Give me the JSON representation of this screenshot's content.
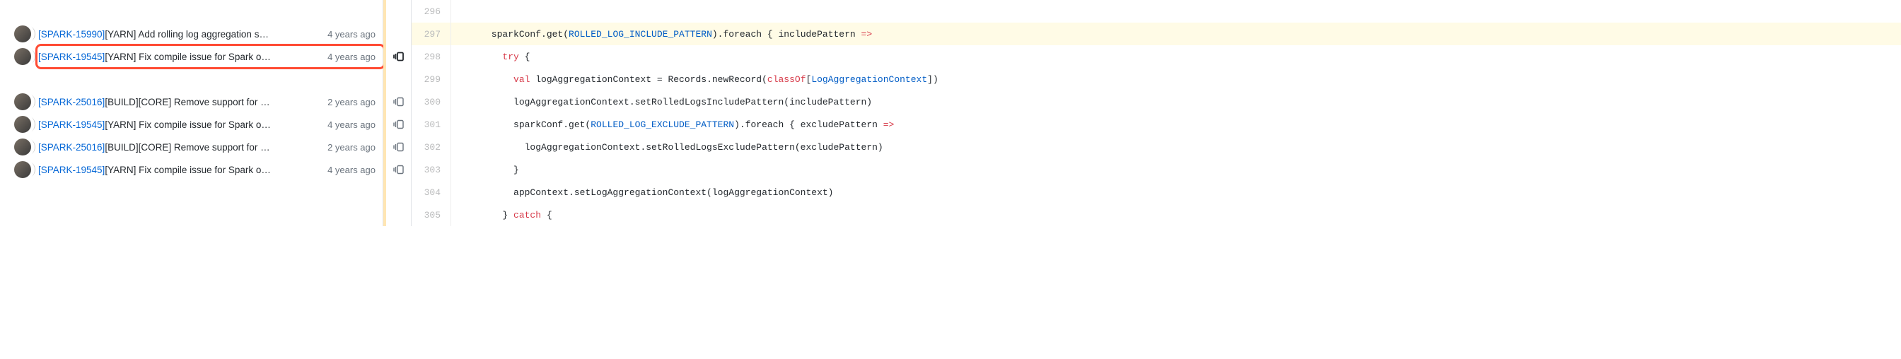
{
  "blame": [
    {
      "issue": "[SPARK-15990]",
      "rest": "[YARN] Add rolling log aggregation s…",
      "age": "4 years ago",
      "avatar": true,
      "reblame": false,
      "highlight": false
    },
    {
      "issue": "[SPARK-19545]",
      "rest": "[YARN] Fix compile issue for Spark o…",
      "age": "4 years ago",
      "avatar": true,
      "reblame": true,
      "highlight": true,
      "reblame_bold": true
    },
    {
      "blank": true
    },
    {
      "issue": "[SPARK-25016]",
      "rest": "[BUILD][CORE] Remove support for …",
      "age": "2 years ago",
      "avatar": true,
      "reblame": true,
      "highlight": false
    },
    {
      "issue": "[SPARK-19545]",
      "rest": "[YARN] Fix compile issue for Spark o…",
      "age": "4 years ago",
      "avatar": true,
      "reblame": true,
      "highlight": false
    },
    {
      "issue": "[SPARK-25016]",
      "rest": "[BUILD][CORE] Remove support for …",
      "age": "2 years ago",
      "avatar": true,
      "reblame": true,
      "highlight": false
    },
    {
      "issue": "[SPARK-19545]",
      "rest": "[YARN] Fix compile issue for Spark o…",
      "age": "4 years ago",
      "avatar": true,
      "reblame": true,
      "highlight": false
    },
    {
      "blank": true
    },
    {
      "blank": true
    }
  ],
  "code": [
    {
      "n": 296,
      "hl": false,
      "segs": []
    },
    {
      "n": 297,
      "hl": true,
      "segs": [
        {
          "t": "      sparkConf.get("
        },
        {
          "t": "ROLLED_LOG_INCLUDE_PATTERN",
          "c": "const"
        },
        {
          "t": ").foreach { includePattern "
        },
        {
          "t": "=>",
          "c": "kw"
        }
      ]
    },
    {
      "n": 298,
      "hl": false,
      "segs": [
        {
          "t": "        "
        },
        {
          "t": "try",
          "c": "kw"
        },
        {
          "t": " {"
        }
      ]
    },
    {
      "n": 299,
      "hl": false,
      "segs": [
        {
          "t": "          "
        },
        {
          "t": "val",
          "c": "kw"
        },
        {
          "t": " logAggregationContext = Records.newRecord("
        },
        {
          "t": "classOf",
          "c": "kw"
        },
        {
          "t": "["
        },
        {
          "t": "LogAggregationContext",
          "c": "const"
        },
        {
          "t": "])"
        }
      ]
    },
    {
      "n": 300,
      "hl": false,
      "segs": [
        {
          "t": "          logAggregationContext.setRolledLogsIncludePattern(includePattern)"
        }
      ]
    },
    {
      "n": 301,
      "hl": false,
      "segs": [
        {
          "t": "          sparkConf.get("
        },
        {
          "t": "ROLLED_LOG_EXCLUDE_PATTERN",
          "c": "const"
        },
        {
          "t": ").foreach { excludePattern "
        },
        {
          "t": "=>",
          "c": "kw"
        }
      ]
    },
    {
      "n": 302,
      "hl": false,
      "segs": [
        {
          "t": "            logAggregationContext.setRolledLogsExcludePattern(excludePattern)"
        }
      ]
    },
    {
      "n": 303,
      "hl": false,
      "segs": [
        {
          "t": "          }"
        }
      ]
    },
    {
      "n": 304,
      "hl": false,
      "segs": [
        {
          "t": "          appContext.setLogAggregationContext(logAggregationContext)"
        }
      ]
    },
    {
      "n": 305,
      "hl": false,
      "segs": [
        {
          "t": "        } "
        },
        {
          "t": "catch",
          "c": "kw"
        },
        {
          "t": " {"
        }
      ]
    }
  ]
}
